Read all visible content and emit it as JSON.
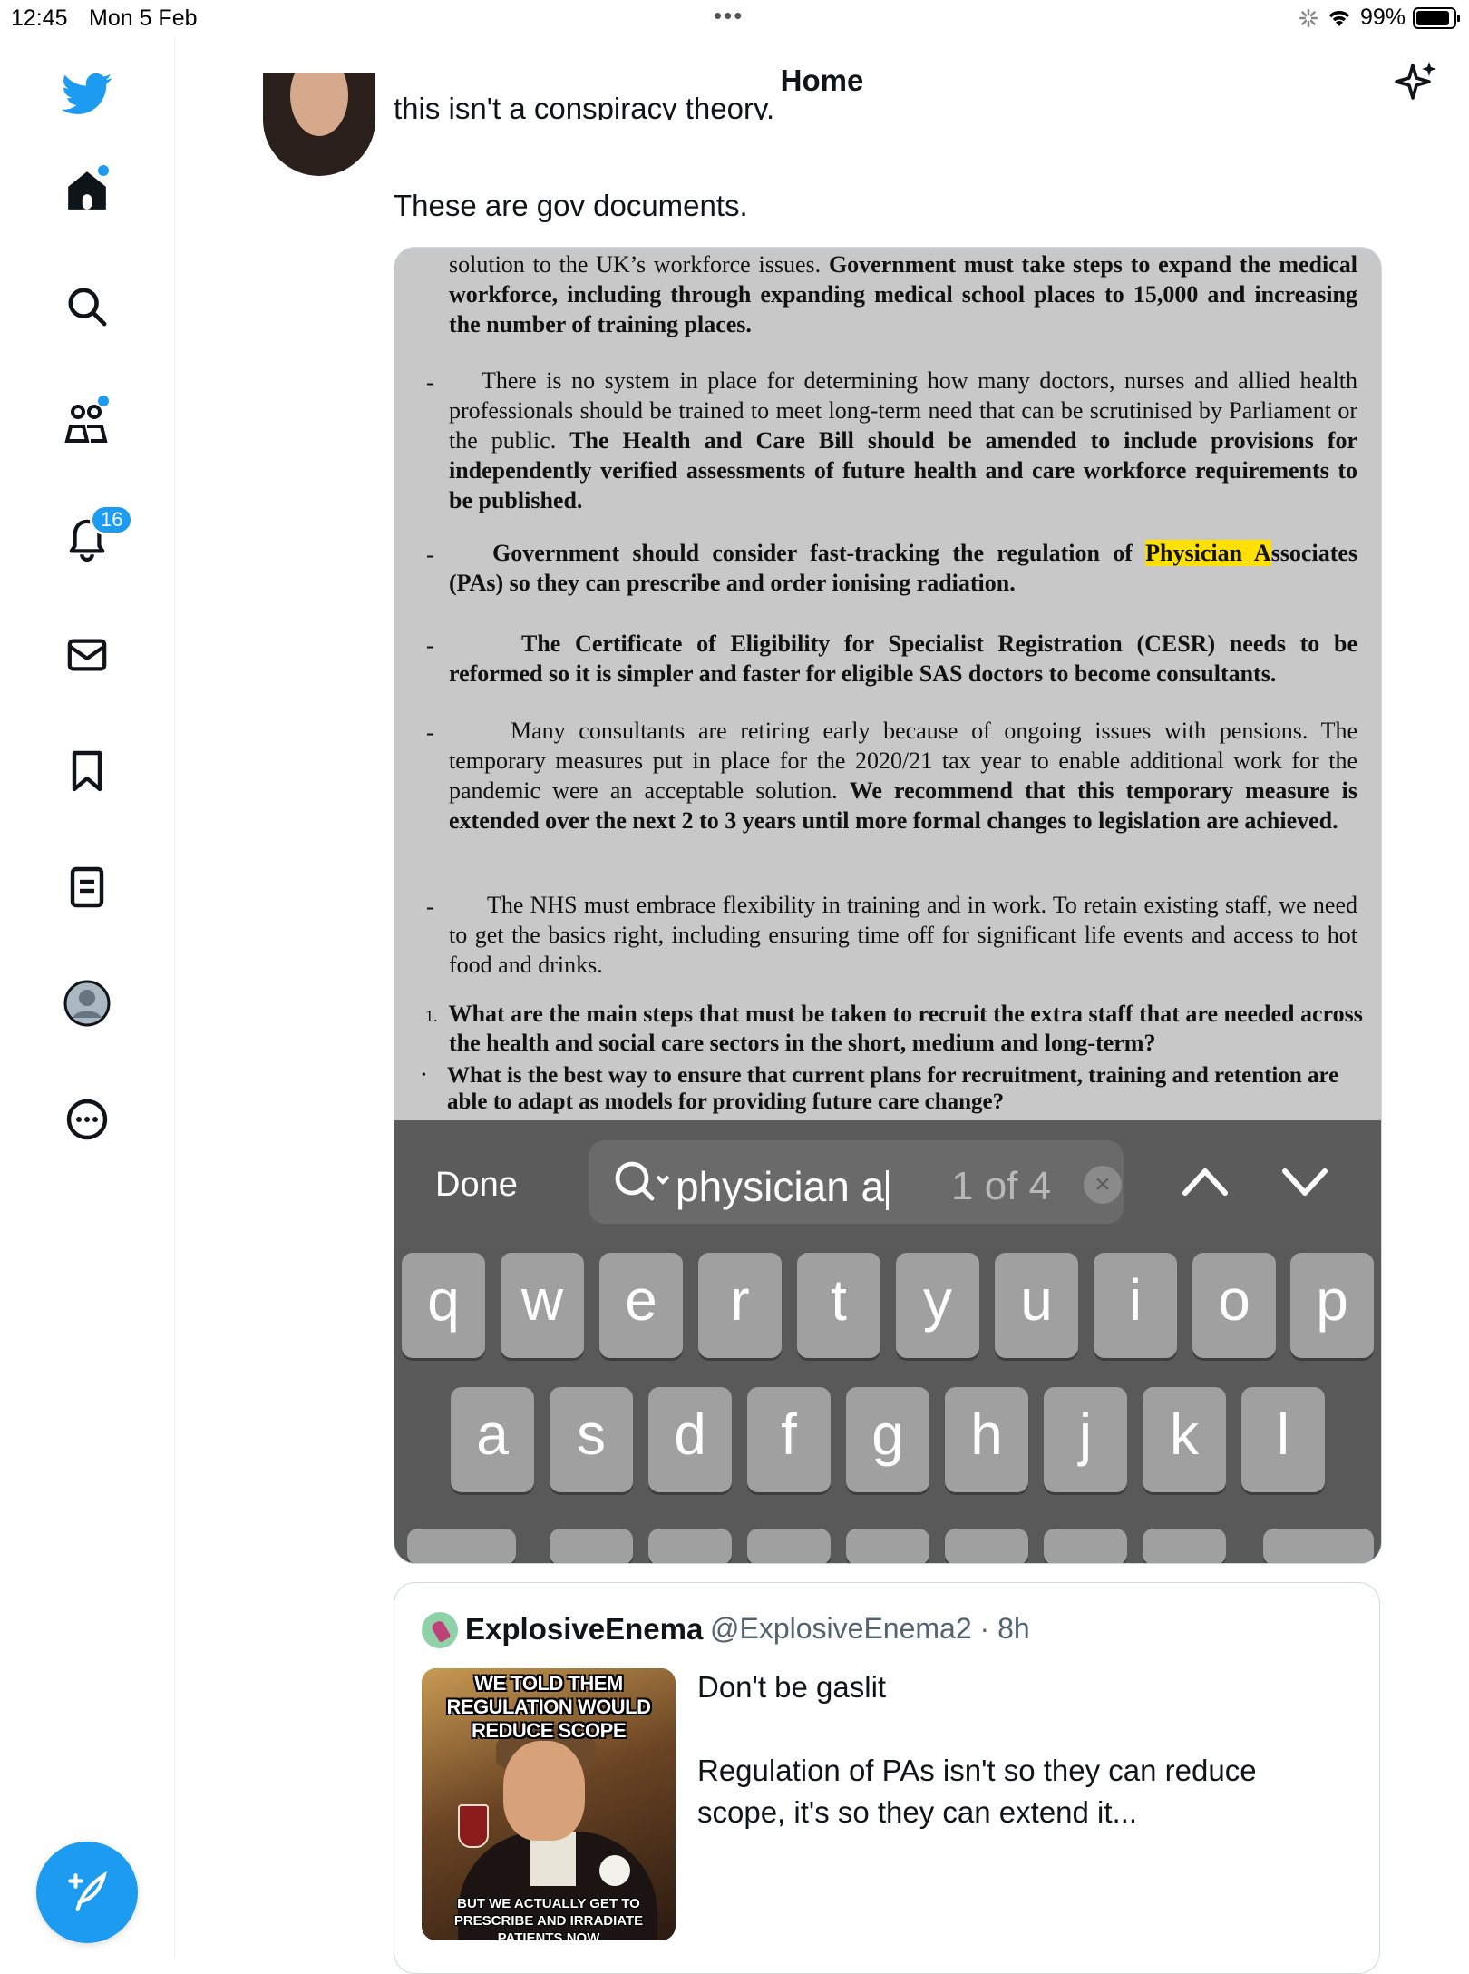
{
  "status_bar": {
    "time": "12:45",
    "date": "Mon 5 Feb",
    "dots": "•••",
    "battery": "99%"
  },
  "sidebar": {
    "nav": [
      {
        "name": "twitter-logo"
      },
      {
        "name": "home"
      },
      {
        "name": "explore"
      },
      {
        "name": "communities"
      },
      {
        "name": "notifications",
        "badge": "16"
      },
      {
        "name": "messages"
      },
      {
        "name": "bookmarks"
      },
      {
        "name": "lists"
      },
      {
        "name": "profile"
      },
      {
        "name": "more"
      }
    ]
  },
  "header": {
    "title": "Home"
  },
  "tweet": {
    "cut_line": "this isn't a conspiracy theory.",
    "text": "These are gov documents."
  },
  "document": {
    "p1a": "solution to the UK’s workforce issues. ",
    "p1b": "Government must take steps to expand the medical workforce, including through expanding medical school places to 15,000 and increasing the number of training places.",
    "p2a": "There is no system in place for determining how many doctors, nurses and allied health professionals should be trained to meet long-term need that can be scrutinised by Parliament or the public. ",
    "p2b": "The Health and Care Bill should be amended to include provisions for independently verified assessments of future health and care workforce requirements to be published.",
    "p3a": "Government should consider fast-tracking the regulation of ",
    "p3hl": "Physician A",
    "p3b": "ssociates (PAs) so they can prescribe and order ionising radiation.",
    "p4": "The Certificate of Eligibility for Specialist Registration (CESR) needs to be reformed so it is simpler and faster for eligible SAS doctors to become consultants.",
    "p5a": "Many consultants are retiring early because of ongoing issues with pensions. The temporary measures put in place for the 2020/21 tax year to enable additional work for the pandemic were an acceptable solution. ",
    "p5b": "We recommend that this temporary measure is extended over the next 2 to 3 years until more formal changes to legislation are achieved.",
    "p6": "The NHS must embrace flexibility in training and in work. To retain existing staff, we need to get the basics right, including ensuring time off for significant life events and access to hot food and drinks.",
    "q_num": "1.",
    "q1": "What are the main steps that must be taken to recruit the extra staff that are needed across the health and social care sectors in the short, medium and long-term?",
    "q2": "What is the best way to ensure that current plans for recruitment, training and retention are able to adapt as models for providing future care change?",
    "dash": "-",
    "bullet": "•"
  },
  "find_bar": {
    "done_label": "Done",
    "query": "physician a",
    "match_count": "1 of 4",
    "clear": "×"
  },
  "keyboard": {
    "row1": [
      "q",
      "w",
      "e",
      "r",
      "t",
      "y",
      "u",
      "i",
      "o",
      "p"
    ],
    "row2": [
      "a",
      "s",
      "d",
      "f",
      "g",
      "h",
      "j",
      "k",
      "l"
    ]
  },
  "quote_tweet": {
    "author": "ExplosiveEnema",
    "handle_time": "@ExplosiveEnema2 · 8h",
    "text": "Don't be gaslit\n\nRegulation of PAs isn't so they can reduce scope, it's so they can extend it...",
    "meme_top": "WE TOLD THEM REGULATION WOULD REDUCE SCOPE",
    "meme_bottom": "BUT WE ACTUALLY GET TO PRESCRIBE AND IRRADIATE PATIENTS NOW"
  },
  "colors": {
    "accent": "#1d9bf0",
    "highlight": "#ffe000",
    "keyboard_bg": "#595959",
    "key_bg": "#a0a0a0"
  }
}
